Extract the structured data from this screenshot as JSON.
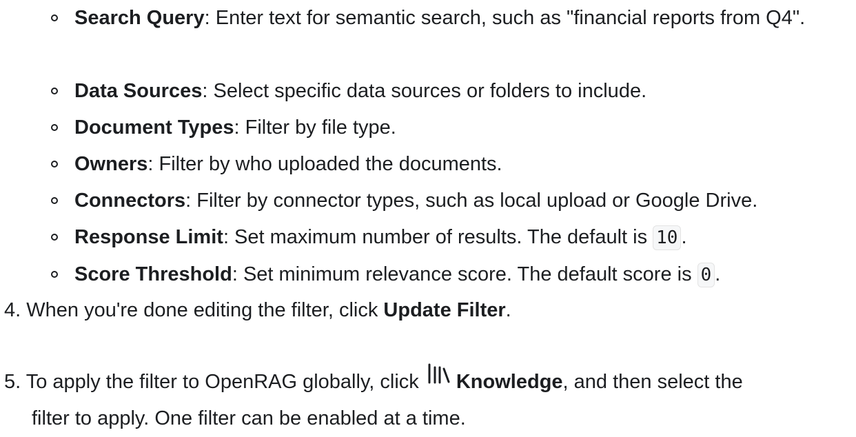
{
  "sub_items": [
    {
      "term": "Search Query",
      "text": ": Enter text for semantic search, such as \"financial reports from Q4\"."
    },
    {
      "term": "Data Sources",
      "text": ": Select specific data sources or folders to include."
    },
    {
      "term": "Document Types",
      "text": ": Filter by file type."
    },
    {
      "term": "Owners",
      "text": ": Filter by who uploaded the documents."
    },
    {
      "term": "Connectors",
      "text": ": Filter by connector types, such as local upload or Google Drive."
    },
    {
      "term": "Response Limit",
      "text": ": Set maximum number of results. The default is ",
      "code": "10",
      "after": "."
    },
    {
      "term": "Score Threshold",
      "text": ": Set minimum relevance score. The default score is ",
      "code": "0",
      "after": "."
    }
  ],
  "step4": {
    "num": "4.",
    "text": "When you're done editing the filter, click ",
    "strong": "Update Filter",
    "after": "."
  },
  "step5": {
    "num": "5.",
    "text": "To apply the filter to OpenRAG globally, click ",
    "icon": "library-icon",
    "strong": "Knowledge",
    "after": ", and then select the",
    "line2": "filter to apply. One filter can be enabled at a time."
  }
}
